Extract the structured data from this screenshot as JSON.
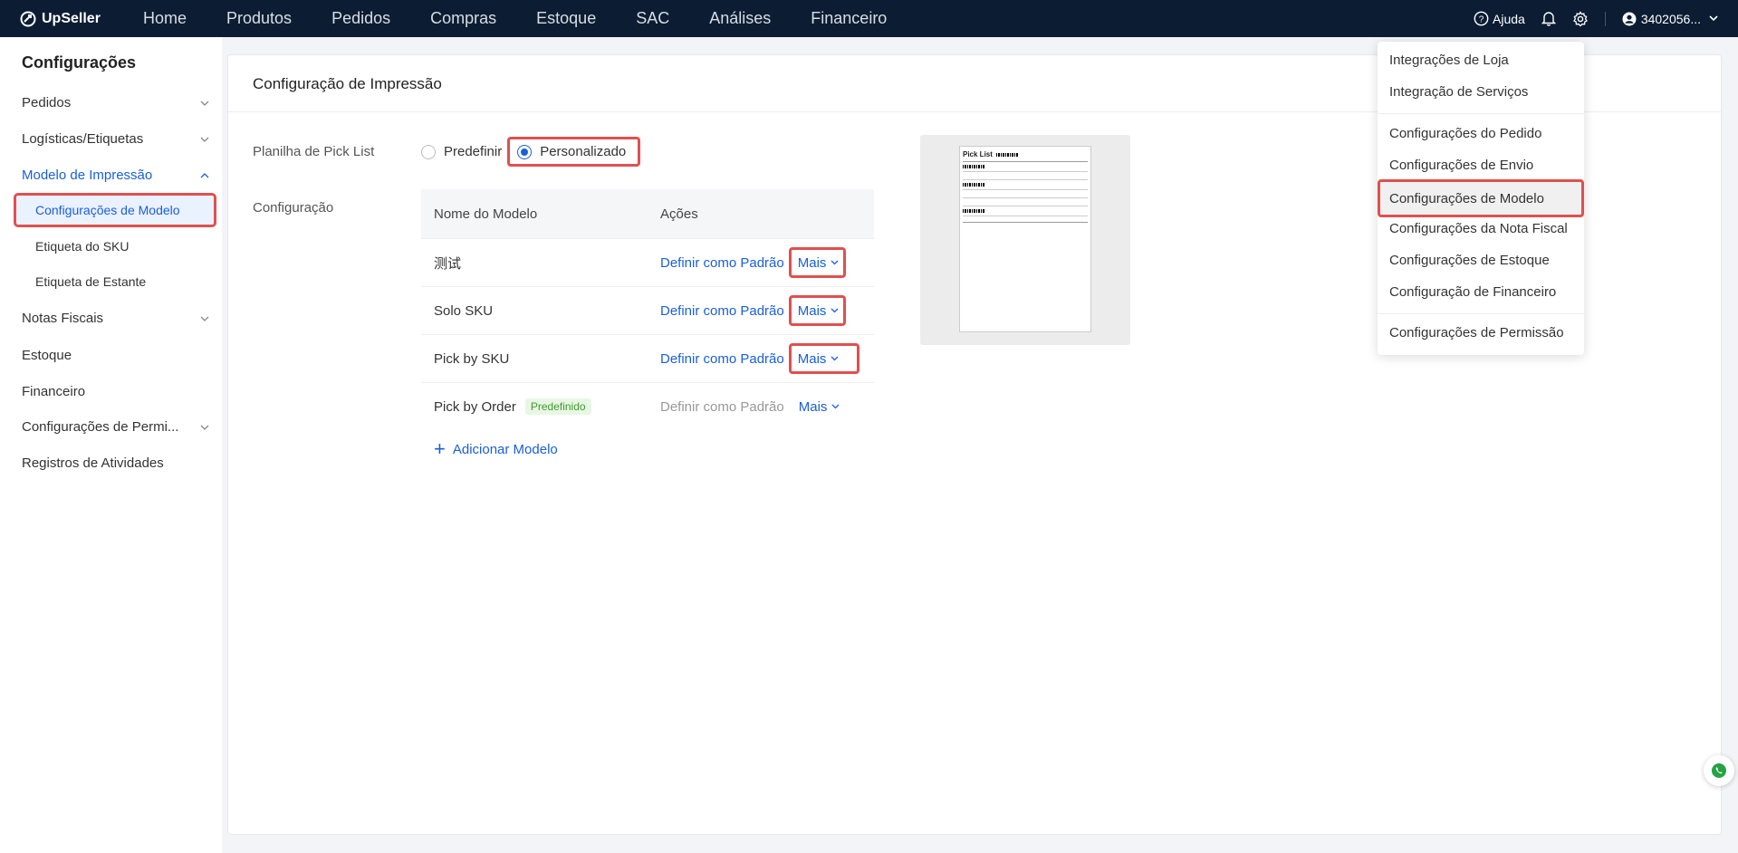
{
  "app": {
    "name": "UpSeller"
  },
  "nav": [
    "Home",
    "Produtos",
    "Pedidos",
    "Compras",
    "Estoque",
    "SAC",
    "Análises",
    "Financeiro"
  ],
  "top_right": {
    "help": "Ajuda",
    "account": "3402056..."
  },
  "sidebar": {
    "title": "Configurações",
    "items": [
      {
        "label": "Pedidos",
        "chevron": "down"
      },
      {
        "label": "Logísticas/Etiquetas",
        "chevron": "down"
      },
      {
        "label": "Modelo de Impressão",
        "chevron": "up",
        "active": true
      },
      {
        "label": "Notas Fiscais",
        "chevron": "down"
      },
      {
        "label": "Estoque"
      },
      {
        "label": "Financeiro"
      },
      {
        "label": "Configurações de Permi...",
        "chevron": "down"
      },
      {
        "label": "Registros de Atividades"
      }
    ],
    "sub_items": [
      {
        "label": "Configurações de Modelo",
        "active": true
      },
      {
        "label": "Etiqueta do SKU"
      },
      {
        "label": "Etiqueta de Estante"
      }
    ]
  },
  "main": {
    "title": "Configuração de Impressão",
    "pick_list_label": "Planilha de Pick List",
    "radio_options": [
      {
        "label": "Predefinir",
        "selected": false
      },
      {
        "label": "Personalizado",
        "selected": true
      }
    ],
    "config_label": "Configuração",
    "table": {
      "headers": [
        "Nome do Modelo",
        "Ações"
      ],
      "rows": [
        {
          "name": "测试",
          "action": "Definir como Padrão",
          "more": "Mais"
        },
        {
          "name": "Solo SKU",
          "action": "Definir como Padrão",
          "more": "Mais"
        },
        {
          "name": "Pick by SKU",
          "action": "Definir como Padrão",
          "more": "Mais"
        },
        {
          "name": "Pick by Order",
          "badge": "Predefinido",
          "action": "Definir como Padrão",
          "more": "Mais"
        }
      ]
    },
    "add_model": "Adicionar Modelo",
    "preview_title": "Pick List"
  },
  "dropdown": {
    "items": [
      "Integrações de Loja",
      "Integração de Serviços",
      "Configurações do Pedido",
      "Configurações de Envio",
      "Configurações de Modelo",
      "Configurações da Nota Fiscal",
      "Configurações de Estoque",
      "Configuração de Financeiro",
      "Configurações de Permissão"
    ],
    "highlighted": "Configurações de Modelo"
  },
  "colors": {
    "topbar": "#0c1d33",
    "accent": "#1a5fd9",
    "highlight_box": "#e05050",
    "badge_green": "#3f9a2c"
  }
}
